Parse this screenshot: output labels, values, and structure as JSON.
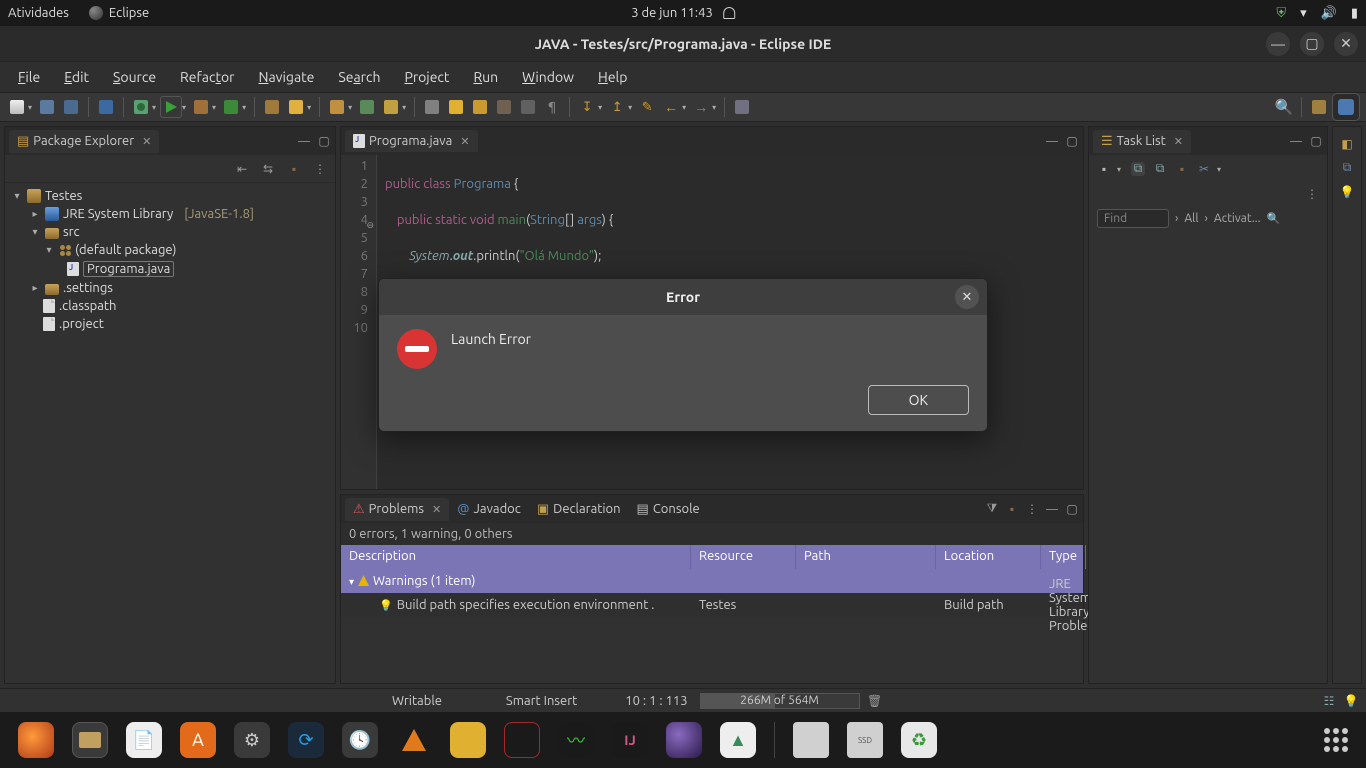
{
  "gnome": {
    "activities": "Atividades",
    "app_name": "Eclipse",
    "date_time": "3 de jun  11:43"
  },
  "window": {
    "title": "JAVA - Testes/src/Programa.java - Eclipse IDE"
  },
  "menu": [
    "File",
    "Edit",
    "Source",
    "Refactor",
    "Navigate",
    "Search",
    "Project",
    "Run",
    "Window",
    "Help"
  ],
  "package_explorer": {
    "title": "Package Explorer",
    "project": "Testes",
    "jre": "JRE System Library",
    "jre_suffix": "[JavaSE-1.8]",
    "src": "src",
    "default_package": "(default package)",
    "file": "Programa.java",
    "settings": ".settings",
    "classpath": ".classpath",
    "project_file": ".project"
  },
  "editor": {
    "tab": "Programa.java",
    "lines": [
      "1",
      "2",
      "3",
      "4",
      "5",
      "6",
      "7",
      "8",
      "9",
      "10"
    ],
    "code": {
      "l2a": "public",
      "l2b": "class",
      "l2c": "Programa",
      "l2d": " {",
      "l4a": "    public",
      "l4b": "static",
      "l4c": "void",
      "l4d": "main",
      "l4e": "(",
      "l4f": "String",
      "l4g": "[] ",
      "l4h": "args",
      "l4i": ") {",
      "l6a": "        System",
      "l6b": ".",
      "l6c": "out",
      "l6d": ".println(",
      "l6e": "\"Olá Mundo\"",
      "l6f": ");"
    }
  },
  "tasklist": {
    "title": "Task List",
    "find": "Find",
    "all": "All",
    "activate": "Activat..."
  },
  "problems": {
    "tabs": [
      "Problems",
      "Javadoc",
      "Declaration",
      "Console"
    ],
    "status": "0 errors, 1 warning, 0 others",
    "columns": [
      "Description",
      "Resource",
      "Path",
      "Location",
      "Type"
    ],
    "warnings_group": "Warnings (1 item)",
    "warning": {
      "desc": "Build path specifies execution environment .",
      "resource": "Testes",
      "path": "",
      "location": "Build path",
      "type": "JRE System Library Problem"
    }
  },
  "statusbar": {
    "writable": "Writable",
    "insert": "Smart Insert",
    "pos": "10 : 1 : 113",
    "mem_used": "266M",
    "mem_sep": " of ",
    "mem_total": "564M"
  },
  "dialog": {
    "title": "Error",
    "message": "Launch Error",
    "ok": "OK"
  }
}
